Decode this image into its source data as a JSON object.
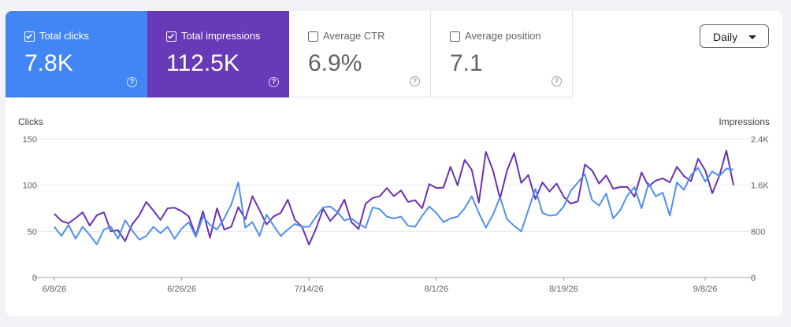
{
  "metrics": [
    {
      "label": "Total clicks",
      "value": "7.8K",
      "checked": true,
      "color": "#4285f4"
    },
    {
      "label": "Total impressions",
      "value": "112.5K",
      "checked": true,
      "color": "#673ab7"
    },
    {
      "label": "Average CTR",
      "value": "6.9%",
      "checked": false
    },
    {
      "label": "Average position",
      "value": "7.1",
      "checked": false
    }
  ],
  "help_glyph": "?",
  "granularity": {
    "selected": "Daily"
  },
  "chart_data": {
    "type": "line",
    "left_axis_label": "Clicks",
    "right_axis_label": "Impressions",
    "left_ylim": [
      0,
      150
    ],
    "right_ylim": [
      0,
      2400
    ],
    "left_ticks": [
      "0",
      "50",
      "100",
      "150"
    ],
    "right_ticks": [
      "0",
      "800",
      "1.6K",
      "2.4K"
    ],
    "x_tick_labels": [
      "6/8/26",
      "6/26/26",
      "7/14/26",
      "8/1/26",
      "8/19/26",
      "9/8/26"
    ],
    "x_tick_index": [
      0,
      18,
      36,
      54,
      72,
      92
    ],
    "grid": true,
    "series": [
      {
        "name": "Clicks",
        "axis": "left",
        "color": "#4f8ff0",
        "values": [
          55,
          45,
          57,
          42,
          55,
          46,
          36,
          52,
          55,
          42,
          62,
          51,
          41,
          45,
          55,
          48,
          55,
          42,
          53,
          60,
          44,
          66,
          57,
          52,
          64,
          79,
          103,
          54,
          60,
          45,
          68,
          56,
          45,
          52,
          58,
          55,
          55,
          66,
          76,
          77,
          71,
          62,
          64,
          58,
          54,
          76,
          74,
          66,
          64,
          66,
          56,
          55,
          67,
          77,
          70,
          60,
          64,
          66,
          75,
          88,
          70,
          54,
          68,
          87,
          63,
          56,
          50,
          73,
          96,
          70,
          67,
          68,
          77,
          94,
          103,
          112,
          84,
          78,
          91,
          64,
          73,
          89,
          98,
          75,
          102,
          88,
          92,
          67,
          103,
          95,
          111,
          119,
          104,
          115,
          110,
          118,
          117
        ]
      },
      {
        "name": "Impressions",
        "axis": "right",
        "color": "#6a32b0",
        "values": [
          1104,
          980,
          940,
          1030,
          1130,
          900,
          1080,
          1130,
          800,
          820,
          630,
          920,
          1080,
          1310,
          1160,
          1000,
          1200,
          1210,
          1150,
          1060,
          720,
          1150,
          690,
          1200,
          830,
          880,
          1220,
          1010,
          1410,
          1170,
          920,
          1060,
          1120,
          1350,
          1000,
          880,
          570,
          850,
          1190,
          980,
          1120,
          1350,
          960,
          840,
          1280,
          1380,
          1410,
          1550,
          1410,
          1510,
          1310,
          1340,
          1200,
          1620,
          1550,
          1560,
          1920,
          1600,
          2040,
          1870,
          1300,
          2180,
          1860,
          1370,
          1860,
          2160,
          1640,
          1780,
          1360,
          1650,
          1490,
          1630,
          1400,
          1280,
          1320,
          1960,
          1860,
          1630,
          1770,
          1540,
          1570,
          1570,
          1400,
          1820,
          1580,
          1680,
          1720,
          1650,
          1920,
          1760,
          1670,
          2060,
          1860,
          1460,
          1760,
          2200,
          1600
        ]
      }
    ]
  }
}
